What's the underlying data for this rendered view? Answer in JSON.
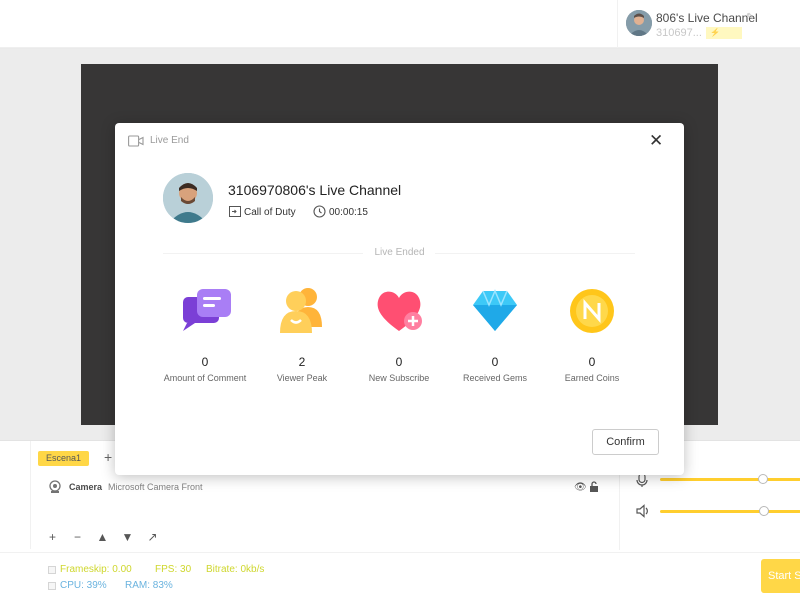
{
  "header": {
    "channel_name": "806's Live Channel",
    "channel_id": "310697...",
    "badge": "⚡"
  },
  "scenes": {
    "active_scene": "Escena1",
    "add_label": "+"
  },
  "sources": [
    {
      "name": "Camera",
      "device": "Microsoft Camera Front"
    }
  ],
  "tools": [
    "+",
    "−",
    "▲",
    "▼",
    "↗"
  ],
  "status": {
    "frameskip": "Frameskip: 0.00",
    "fps": "FPS: 30",
    "bitrate": "Bitrate: 0kb/s",
    "cpu": "CPU: 39%",
    "ram": "RAM: 83%",
    "start_label": "Start S"
  },
  "audio": {
    "mic_level": 0.72,
    "speaker_level": 0.73
  },
  "modal": {
    "title": "Live End",
    "channel": "3106970806's Live Channel",
    "game": "Call of Duty",
    "duration": "00:00:15",
    "ended_label": "Live Ended",
    "confirm_label": "Confirm",
    "stats": [
      {
        "value": "0",
        "label": "Amount of Comment",
        "icon": "comment-icon"
      },
      {
        "value": "2",
        "label": "Viewer Peak",
        "icon": "viewer-icon"
      },
      {
        "value": "0",
        "label": "New Subscribe",
        "icon": "heart-plus-icon"
      },
      {
        "value": "0",
        "label": "Received Gems",
        "icon": "gem-icon"
      },
      {
        "value": "0",
        "label": "Earned Coins",
        "icon": "coin-icon"
      }
    ]
  },
  "colors": {
    "accent": "#ffcf1f",
    "status_green": "#c5cf00",
    "status_blue": "#4aa3d8"
  }
}
